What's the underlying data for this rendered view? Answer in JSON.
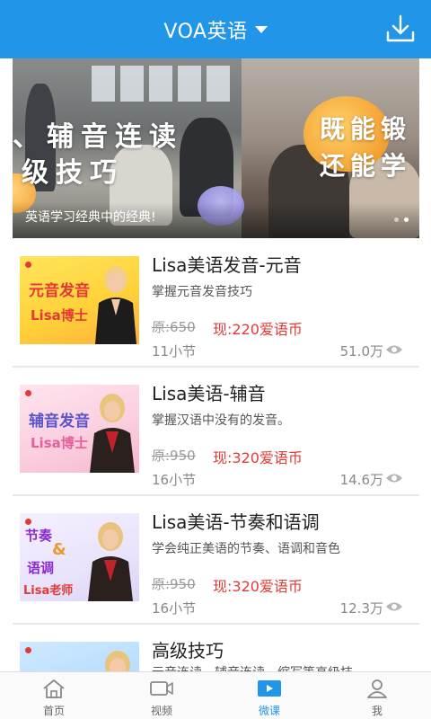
{
  "header": {
    "title": "VOA英语",
    "dropdown_icon": "caret-down-icon",
    "download_icon": "download-icon"
  },
  "banner": {
    "line1": "、辅音连读",
    "line2": "级技巧",
    "line3": "既能锻",
    "line4": "还能学",
    "caption": "英语学习经典中的经典!"
  },
  "courses": [
    {
      "thumb_line1": "元音发音",
      "thumb_line2": "Lisa博士",
      "title": "Lisa美语发音-元音",
      "desc": "掌握元音发音技巧",
      "old_price": "原:650",
      "new_price": "现:220爱语币",
      "lessons": "11小节",
      "views": "51.0万"
    },
    {
      "thumb_line1": "辅音发音",
      "thumb_line2": "Lisa博士",
      "title": "Lisa美语-辅音",
      "desc": "掌握汉语中没有的发音。",
      "old_price": "原:950",
      "new_price": "现:320爱语币",
      "lessons": "16小节",
      "views": "14.6万"
    },
    {
      "thumb_line1": "节奏",
      "thumb_line1b": "&",
      "thumb_line1c": "语调",
      "thumb_line2": "Lisa老师",
      "title": "Lisa美语-节奏和语调",
      "desc": "学会纯正美语的节奏、语调和音色",
      "old_price": "原:950",
      "new_price": "现:320爱语币",
      "lessons": "16小节",
      "views": "12.3万"
    },
    {
      "title": "高级技巧",
      "desc": "元音连读、辅音连读、缩写等高级技"
    }
  ],
  "tabbar": {
    "items": [
      {
        "label": "首页",
        "icon": "home-icon"
      },
      {
        "label": "视频",
        "icon": "video-icon"
      },
      {
        "label": "微课",
        "icon": "play-icon",
        "active": true
      },
      {
        "label": "我",
        "icon": "user-icon"
      }
    ]
  },
  "colors": {
    "accent": "#2196e8",
    "price": "#e53935"
  }
}
